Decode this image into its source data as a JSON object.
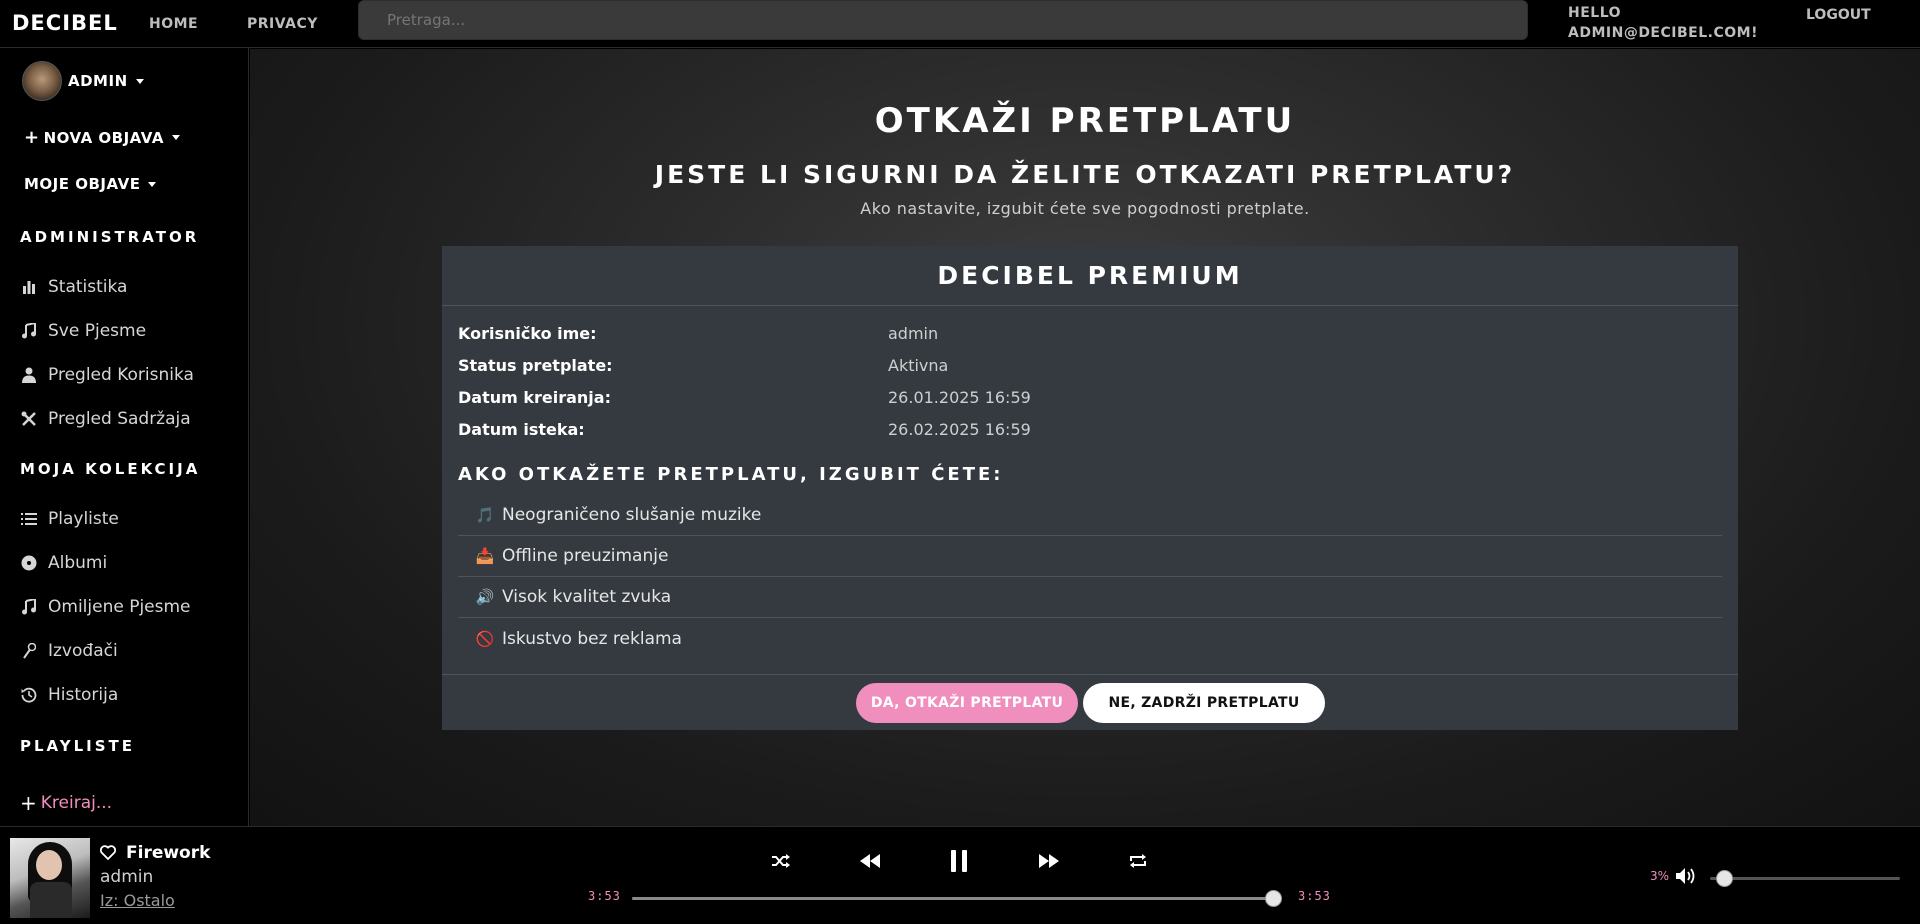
{
  "nav": {
    "brand": "DECIBEL",
    "home": "HOME",
    "privacy": "PRIVACY",
    "search_placeholder": "Pretraga...",
    "hello_line1": "HELLO",
    "hello_line2": "ADMIN@DECIBEL.COM!",
    "logout": "LOGOUT"
  },
  "sidebar": {
    "user": "ADMIN",
    "new_post": "NOVA OBJAVA",
    "my_posts": "MOJE OBJAVE",
    "admin_heading": "ADMINISTRATOR",
    "admin_items": [
      {
        "label": "Statistika",
        "icon": "bar-chart-icon"
      },
      {
        "label": "Sve Pjesme",
        "icon": "music-note-icon"
      },
      {
        "label": "Pregled Korisnika",
        "icon": "user-icon"
      },
      {
        "label": "Pregled Sadržaja",
        "icon": "tools-icon"
      }
    ],
    "collection_heading": "MOJA KOLEKCIJA",
    "collection_items": [
      {
        "label": "Playliste",
        "icon": "list-icon"
      },
      {
        "label": "Albumi",
        "icon": "disc-icon"
      },
      {
        "label": "Omiljene Pjesme",
        "icon": "music-note-icon"
      },
      {
        "label": "Izvođači",
        "icon": "microphone-icon"
      },
      {
        "label": "Historija",
        "icon": "history-icon"
      }
    ],
    "playlists_heading": "PLAYLISTE",
    "create": "Kreiraj..."
  },
  "main": {
    "title": "OTKAŽI PRETPLATU",
    "question": "JESTE LI SIGURNI DA ŽELITE OTKAZATI PRETPLATU?",
    "subtext": "Ako nastavite, izgubit ćete sve pogodnosti pretplate.",
    "card": {
      "title": "DECIBEL PREMIUM",
      "rows": [
        {
          "key": "Korisničko ime:",
          "value": "admin"
        },
        {
          "key": "Status pretplate:",
          "value": "Aktivna"
        },
        {
          "key": "Datum kreiranja:",
          "value": "26.01.2025 16:59"
        },
        {
          "key": "Datum isteka:",
          "value": "26.02.2025 16:59"
        }
      ],
      "lose_heading": "AKO OTKAŽETE PRETPLATU, IZGUBIT ĆETE:",
      "features": [
        {
          "emoji": "🎵",
          "label": "Neograničeno slušanje muzike"
        },
        {
          "emoji": "📥",
          "label": "Offline preuzimanje"
        },
        {
          "emoji": "🔊",
          "label": "Visok kvalitet zvuka"
        },
        {
          "emoji": "🚫",
          "label": "Iskustvo bez reklama"
        }
      ],
      "cancel_button": "DA, OTKAŽI PRETPLATU",
      "keep_button": "NE, ZADRŽI PRETPLATU"
    }
  },
  "player": {
    "title": "Firework",
    "artist": "admin",
    "from": "Iz: Ostalo",
    "time_current": "3:53",
    "time_total": "3:53",
    "progress": 1.0,
    "volume_label": "3%",
    "volume": 0.03,
    "accent_color": "#f08ebd"
  }
}
